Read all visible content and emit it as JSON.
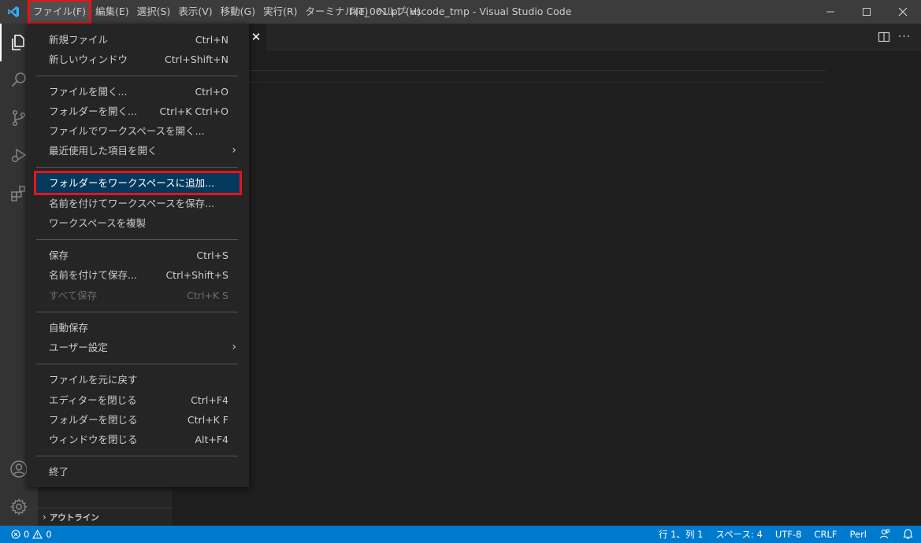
{
  "titlebar": {
    "menus": [
      "ファイル(F)",
      "編集(E)",
      "選択(S)",
      "表示(V)",
      "移動(G)",
      "実行(R)",
      "ターミナル(T)",
      "ヘルプ(H)"
    ],
    "window_title": "file_001.pl - vscode_tmp - Visual Studio Code"
  },
  "file_menu": {
    "new_file": {
      "label": "新規ファイル",
      "shortcut": "Ctrl+N"
    },
    "new_window": {
      "label": "新しいウィンドウ",
      "shortcut": "Ctrl+Shift+N"
    },
    "open_file": {
      "label": "ファイルを開く...",
      "shortcut": "Ctrl+O"
    },
    "open_folder": {
      "label": "フォルダーを開く...",
      "shortcut": "Ctrl+K Ctrl+O"
    },
    "open_workspace": {
      "label": "ファイルでワークスペースを開く..."
    },
    "open_recent": {
      "label": "最近使用した項目を開く"
    },
    "add_folder": {
      "label": "フォルダーをワークスペースに追加..."
    },
    "save_workspace_as": {
      "label": "名前を付けてワークスペースを保存..."
    },
    "duplicate_workspace": {
      "label": "ワークスペースを複製"
    },
    "save": {
      "label": "保存",
      "shortcut": "Ctrl+S"
    },
    "save_as": {
      "label": "名前を付けて保存...",
      "shortcut": "Ctrl+Shift+S"
    },
    "save_all": {
      "label": "すべて保存",
      "shortcut": "Ctrl+K S"
    },
    "auto_save": {
      "label": "自動保存"
    },
    "preferences": {
      "label": "ユーザー設定"
    },
    "revert_file": {
      "label": "ファイルを元に戻す"
    },
    "close_editor": {
      "label": "エディターを閉じる",
      "shortcut": "Ctrl+F4"
    },
    "close_folder": {
      "label": "フォルダーを閉じる",
      "shortcut": "Ctrl+K F"
    },
    "close_window": {
      "label": "ウィンドウを閉じる",
      "shortcut": "Alt+F4"
    },
    "exit": {
      "label": "終了"
    }
  },
  "sidebar": {
    "outline_label": "アウトライン"
  },
  "statusbar": {
    "errors": "0",
    "warnings": "0",
    "position": "行 1、列 1",
    "spaces": "スペース: 4",
    "encoding": "UTF-8",
    "eol": "CRLF",
    "language": "Perl"
  },
  "colors": {
    "accent": "#007acc",
    "highlight_box": "#e81416",
    "selected_item": "#04395e"
  },
  "icons": [
    "vscode-logo-icon",
    "explorer-icon",
    "search-icon",
    "source-control-icon",
    "run-debug-icon",
    "extensions-icon",
    "accounts-icon",
    "manage-gear-icon",
    "split-editor-icon",
    "close-icon",
    "minimize-icon",
    "maximize-icon",
    "error-icon",
    "warning-icon",
    "feedback-icon",
    "bell-icon"
  ]
}
